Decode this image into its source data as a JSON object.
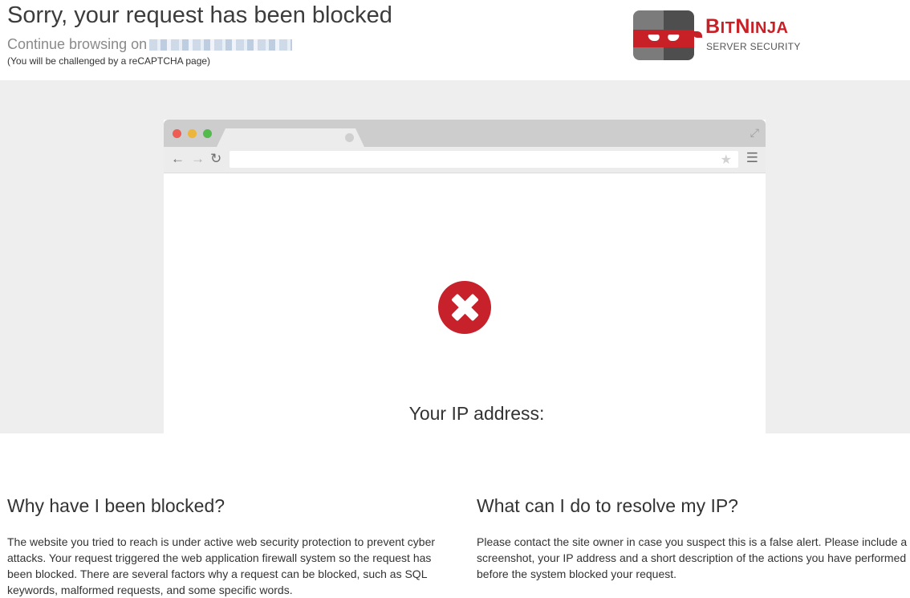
{
  "header": {
    "title": "Sorry, your request has been blocked",
    "continue_text": "Continue browsing on",
    "recaptcha_hint": "(You will be challenged by a reCAPTCHA page)"
  },
  "logo": {
    "brand_main": "BitNinja",
    "brand_sub": "SERVER SECURITY",
    "brand_color": "#c72027"
  },
  "browser_mock": {
    "icons": [
      "back-arrow-icon",
      "forward-arrow-icon",
      "reload-icon",
      "star-icon",
      "menu-icon",
      "expand-icon"
    ],
    "blocked_icon": "error-x-icon",
    "ip_label": "Your IP address:"
  },
  "why": {
    "heading": "Why have I been blocked?",
    "body": "The website you tried to reach is under active web security protection to prevent cyber attacks. Your request triggered the web application firewall system so the request has been blocked. There are several factors why a request can be blocked, such as SQL keywords, malformed requests, and some specific words."
  },
  "resolve": {
    "heading": "What can I do to resolve my IP?",
    "body": "Please contact the site owner in case you suspect this is a false alert. Please include a screenshot, your IP address and a short description of the actions you have performed before the system blocked your request."
  }
}
